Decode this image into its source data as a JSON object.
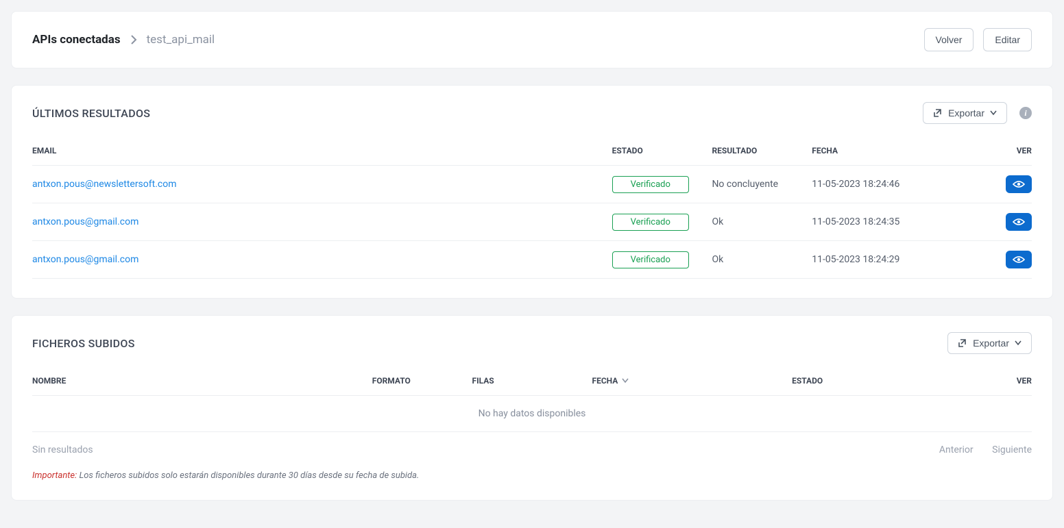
{
  "header": {
    "breadcrumb_root": "APIs conectadas",
    "breadcrumb_leaf": "test_api_mail",
    "back_label": "Volver",
    "edit_label": "Editar"
  },
  "results": {
    "title": "ÚLTIMOS RESULTADOS",
    "export_label": "Exportar",
    "columns": {
      "email": "EMAIL",
      "estado": "ESTADO",
      "resultado": "RESULTADO",
      "fecha": "FECHA",
      "ver": "VER"
    },
    "rows": [
      {
        "email": "antxon.pous@newslettersoft.com",
        "estado": "Verificado",
        "resultado": "No concluyente",
        "fecha": "11-05-2023 18:24:46"
      },
      {
        "email": "antxon.pous@gmail.com",
        "estado": "Verificado",
        "resultado": "Ok",
        "fecha": "11-05-2023 18:24:35"
      },
      {
        "email": "antxon.pous@gmail.com",
        "estado": "Verificado",
        "resultado": "Ok",
        "fecha": "11-05-2023 18:24:29"
      }
    ]
  },
  "files": {
    "title": "FICHEROS SUBIDOS",
    "export_label": "Exportar",
    "columns": {
      "nombre": "NOMBRE",
      "formato": "FORMATO",
      "filas": "FILAS",
      "fecha": "FECHA",
      "estado": "ESTADO",
      "ver": "VER"
    },
    "no_data": "No hay datos disponibles",
    "no_results": "Sin resultados",
    "prev_label": "Anterior",
    "next_label": "Siguiente",
    "note_key": "Importante:",
    "note_text": "Los ficheros subidos solo estarán disponibles durante 30 días desde su fecha de subida."
  }
}
